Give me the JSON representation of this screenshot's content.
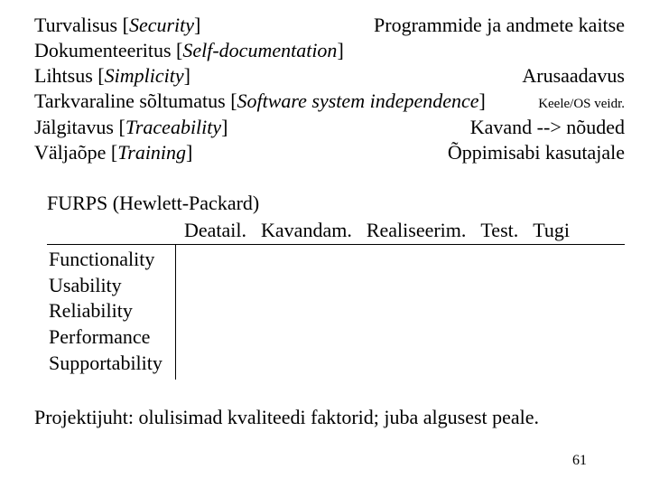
{
  "terms": [
    {
      "et": "Turvalisus",
      "en": "Security",
      "desc": "Programmide ja andmete kaitse"
    },
    {
      "et": "Dokumenteeritus",
      "en": "Self-documentation",
      "desc": ""
    },
    {
      "et": "Lihtsus",
      "en": "Simplicity",
      "desc": "Arusaadavus"
    },
    {
      "et": "Tarkvaraline sõltumatus",
      "en": "Software system independence",
      "desc": "Keele/OS veidr."
    },
    {
      "et": "Jälgitavus",
      "en": "Traceability",
      "desc": "Kavand --> nõuded"
    },
    {
      "et": "Väljaõpe",
      "en": "Training",
      "desc": "Õppimisabi kasutajale"
    }
  ],
  "furps": {
    "title": "FURPS  (Hewlett-Packard)",
    "columns": [
      "Deatail.",
      "Kavandam.",
      "Realiseerim.",
      "Test.",
      "Tugi"
    ],
    "rows": [
      "Functionality",
      "Usability",
      "Reliability",
      "Performance",
      "Supportability"
    ]
  },
  "footer": "Projektijuht: olulisimad kvaliteedi faktorid; juba algusest peale.",
  "page": "61"
}
